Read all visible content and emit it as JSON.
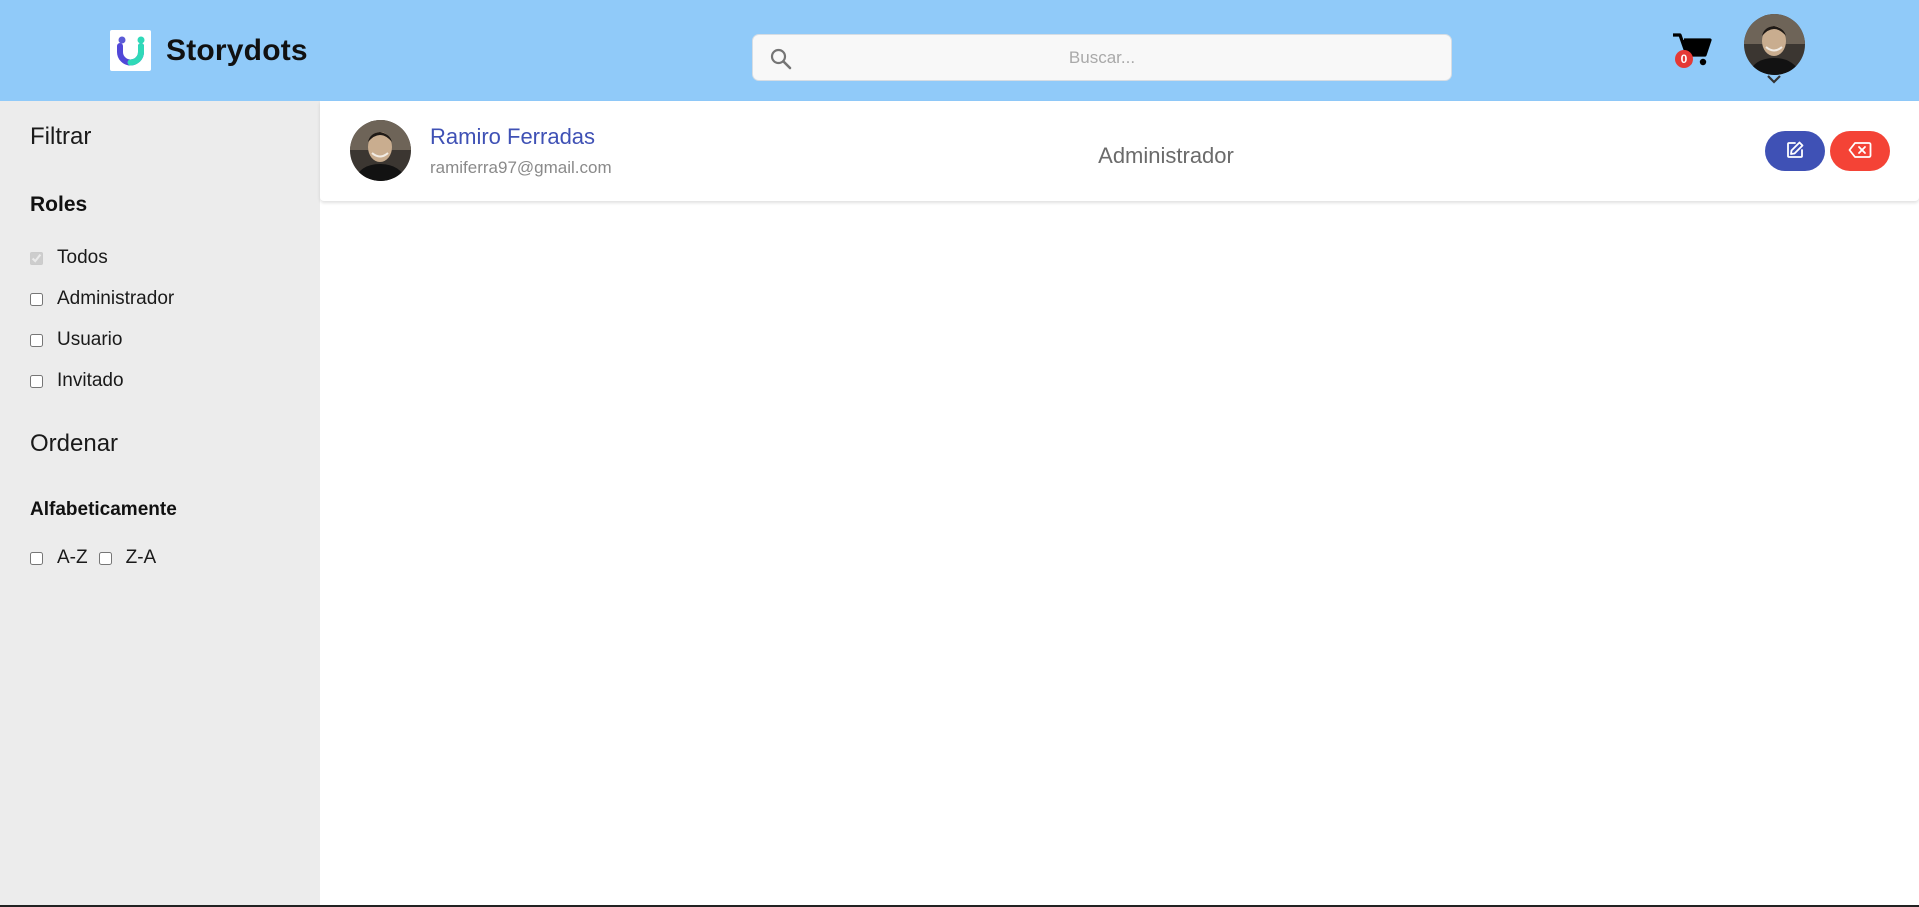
{
  "header": {
    "brand_name": "Storydots",
    "search_placeholder": "Buscar...",
    "cart_count": "0",
    "background_color": "#90caf9"
  },
  "sidebar": {
    "filter_title": "Filtrar",
    "roles_title": "Roles",
    "roles": [
      {
        "label": "Todos",
        "checked": true,
        "disabled": true
      },
      {
        "label": "Administrador",
        "checked": false
      },
      {
        "label": "Usuario",
        "checked": false
      },
      {
        "label": "Invitado",
        "checked": false
      }
    ],
    "sort_title": "Ordenar",
    "alpha_title": "Alfabeticamente",
    "sort_options": [
      {
        "label": "A-Z",
        "checked": false
      },
      {
        "label": "Z-A",
        "checked": false
      }
    ]
  },
  "users": [
    {
      "name": "Ramiro Ferradas",
      "email": "ramiferra97@gmail.com",
      "role": "Administrador"
    }
  ],
  "colors": {
    "accent": "#3f51b5",
    "danger": "#f44336",
    "sidebar_bg": "#ececec"
  },
  "icons": {
    "search": "search-icon",
    "cart": "cart-icon",
    "chevron": "chevron-down-icon",
    "edit": "edit-icon",
    "delete": "backspace-icon"
  }
}
